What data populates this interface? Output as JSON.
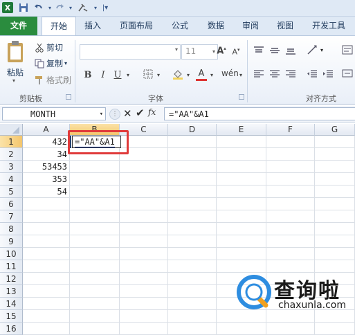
{
  "qat": {
    "app_icon": "excel-icon",
    "icons": [
      "save-icon",
      "undo-icon",
      "redo-icon",
      "customize-icon"
    ]
  },
  "tabs": {
    "file": "文件",
    "home": "开始",
    "insert": "插入",
    "page_layout": "页面布局",
    "formulas": "公式",
    "data": "数据",
    "review": "审阅",
    "view": "视图",
    "developer": "开发工具"
  },
  "ribbon": {
    "paste": "粘贴",
    "cut": "剪切",
    "copy": "复制",
    "format_painter": "格式刷",
    "clipboard_group": "剪贴板",
    "font_size": "11",
    "bold": "B",
    "italic": "I",
    "underline": "U",
    "font_group": "字体",
    "align_group": "对齐方式"
  },
  "formula_bar": {
    "name_box": "MONTH",
    "fx": "fx",
    "formula": "=\"AA\"&A1"
  },
  "grid": {
    "columns": [
      "A",
      "B",
      "C",
      "D",
      "E",
      "F",
      "G"
    ],
    "rows": [
      "1",
      "2",
      "3",
      "4",
      "5",
      "6",
      "7",
      "8",
      "9",
      "10",
      "11",
      "12",
      "13",
      "14",
      "15",
      "16"
    ],
    "a_values": [
      "432",
      "34",
      "53453",
      "353",
      "54"
    ],
    "b1_edit": "=\"AA\"&A1"
  },
  "watermark": {
    "text": "查询啦",
    "url": "chaxunla.com"
  },
  "colors": {
    "file_tab": "#2a8c3e",
    "highlight_box": "#e03a3a",
    "selected_header": "#f4c66d"
  }
}
